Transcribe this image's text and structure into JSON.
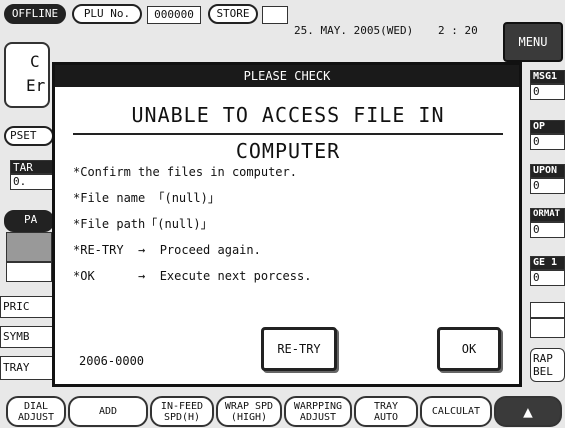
{
  "topbar": {
    "offline": "OFFLINE",
    "plu_label": "PLU No.",
    "plu_value": "000000",
    "store_label": "STORE",
    "date": "25. MAY. 2005(WED)",
    "time": "2 : 20",
    "menu": "MENU"
  },
  "background": {
    "left_c": "C",
    "left_er": "Er",
    "pset": "PSET",
    "tar": "TAR",
    "tar_value": "0.",
    "pa": "PA",
    "pric": "PRIC",
    "symb": "SYMB",
    "tray": "TRAY",
    "right_msg": "MSG1",
    "right_msg_val": "0",
    "right_op": "OP",
    "right_op_val": "0",
    "right_upon": "UPON",
    "right_upon_val": "0",
    "right_ormat": "ORMAT",
    "right_ormat_val": "0",
    "right_ge": "GE 1",
    "right_ge_val": "0",
    "right_rap": "RAP\nBEL"
  },
  "bottom_bar": [
    {
      "label": "DIAL\nADJUST"
    },
    {
      "label": "ADD"
    },
    {
      "label": "IN-FEED\nSPD(H)"
    },
    {
      "label": "WRAP SPD\n(HIGH)"
    },
    {
      "label": "WARPPING\nADJUST"
    },
    {
      "label": "TRAY\nAUTO"
    },
    {
      "label": "CALCULAT"
    },
    {
      "label": "▲"
    }
  ],
  "dialog": {
    "title": "PLEASE CHECK",
    "heading": "UNABLE TO ACCESS FILE IN COMPUTER",
    "lines": [
      "*Confirm the files in computer.",
      "*File name 「(null)」",
      "*File path「(null)」",
      "*RE-TRY  →  Proceed again.",
      "*OK      →  Execute next porcess."
    ],
    "code": "2006-0000",
    "retry": "RE-TRY",
    "ok": "OK"
  }
}
